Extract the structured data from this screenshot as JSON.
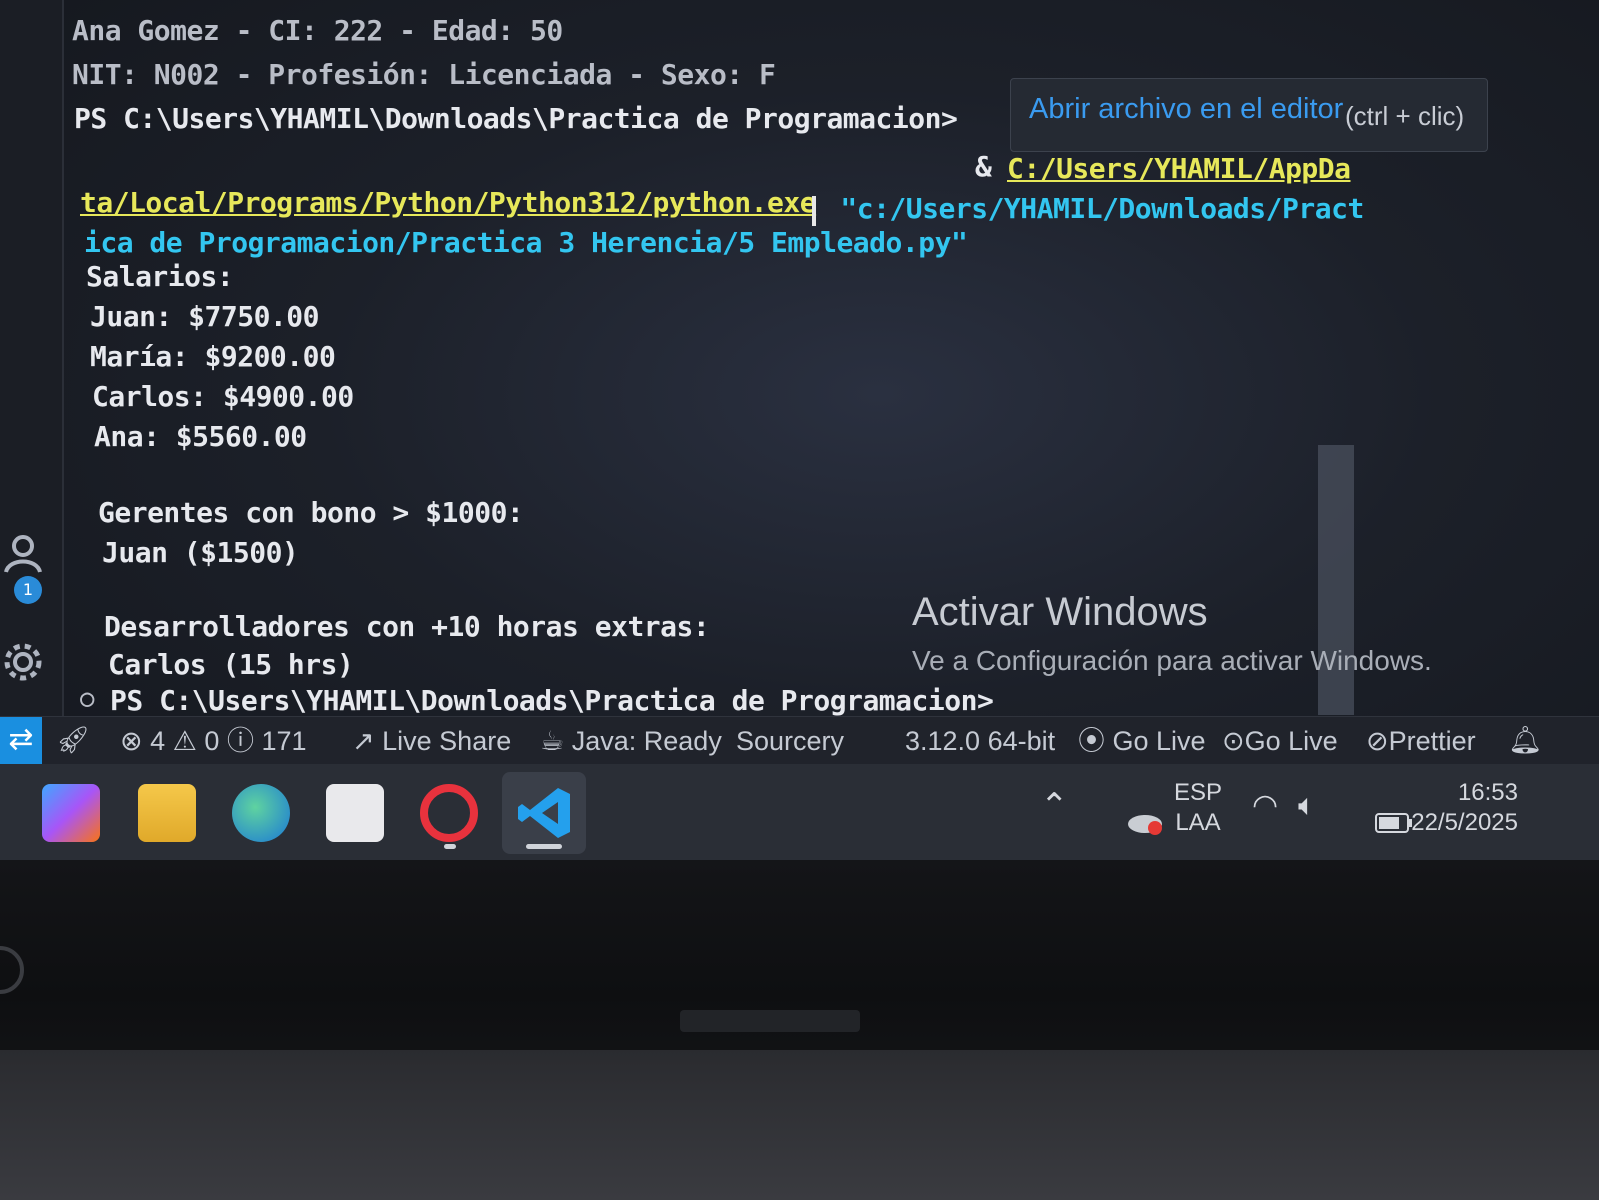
{
  "terminal": {
    "lines": {
      "l1": "Ana Gomez - CI: 222 - Edad: 50",
      "l2": "NIT: N002 - Profesión: Licenciada - Sexo: F",
      "l3": "PS C:\\Users\\YHAMIL\\Downloads\\Practica de Programacion>",
      "l4_amp": "& ",
      "l4_path": "C:/Users/YHAMIL/AppDa",
      "l5_path": "ta/Local/Programs/Python/Python312/python.exe",
      "l5_arg": " \"c:/Users/YHAMIL/Downloads/Pract",
      "l6_arg": "ica de Programacion/Practica 3 Herencia/5 Empleado.py\"",
      "l7": "Salarios:",
      "l8": "Juan: $7750.00",
      "l9": "María: $9200.00",
      "l10": "Carlos: $4900.00",
      "l11": "Ana: $5560.00",
      "l12": "Gerentes con bono > $1000:",
      "l13": "Juan ($1500)",
      "l14": "Desarrolladores con +10 horas extras:",
      "l15": "Carlos (15 hrs)",
      "l16_marker": "○",
      "l16": "PS C:\\Users\\YHAMIL\\Downloads\\Practica de Programacion>"
    },
    "hover": {
      "link": "Abrir archivo en el editor",
      "hint": "(ctrl + clic)"
    }
  },
  "activate_windows": {
    "title": "Activar Windows",
    "subtitle": "Ve a Configuración para activar Windows."
  },
  "activity_bar": {
    "badge": "1",
    "icons": [
      "accounts-icon",
      "gear-icon"
    ]
  },
  "statusbar": {
    "remote_icon": "remote-icon",
    "errors": "4",
    "warnings": "0",
    "infos": "171",
    "live_share": "Live Share",
    "java": "Java: Ready",
    "sourcery": "Sourcery",
    "python_version": "3.12.0 64-bit",
    "go_live_1": "Go Live",
    "go_live_2": "Go Live",
    "prettier": "Prettier"
  },
  "taskbar": {
    "apps": [
      "copilot-icon",
      "file-explorer-icon",
      "edge-icon",
      "store-icon",
      "opera-icon",
      "vscode-icon"
    ],
    "lang_top": "ESP",
    "lang_bottom": "LAA",
    "time": "16:53",
    "date": "22/5/2025"
  },
  "colors": {
    "terminal_text": "#e7e9ee",
    "link_yellow": "#e7e85a",
    "string_cyan": "#33c6f0",
    "hover_blue": "#3a9bf0",
    "statusbar_bg": "#20232b",
    "remote_blue": "#1a8fe0"
  }
}
